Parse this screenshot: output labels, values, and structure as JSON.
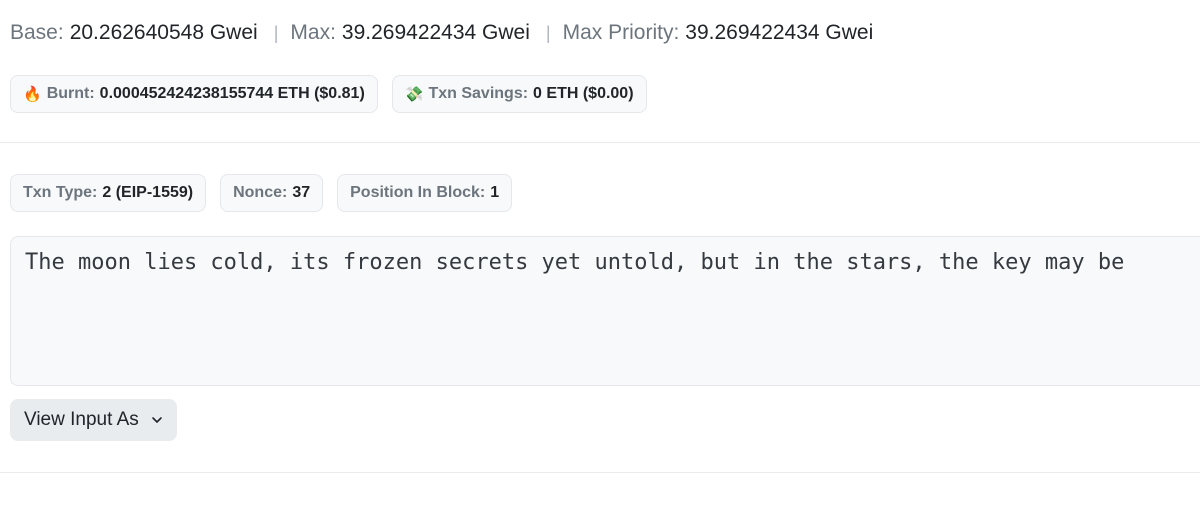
{
  "gas": {
    "base_label": "Base:",
    "base_value": "20.262640548 Gwei",
    "max_label": "Max:",
    "max_value": "39.269422434 Gwei",
    "max_priority_label": "Max Priority:",
    "max_priority_value": "39.269422434 Gwei",
    "separator": "|"
  },
  "fees": {
    "burnt_icon": "fire-icon",
    "burnt_glyph": "🔥",
    "burnt_label": "Burnt:",
    "burnt_value": "0.000452424238155744 ETH ($0.81)",
    "savings_icon": "money-icon",
    "savings_glyph": "💸",
    "savings_label": "Txn Savings:",
    "savings_value": "0 ETH ($0.00)"
  },
  "attributes": {
    "txn_type_label": "Txn Type:",
    "txn_type_value": "2 (EIP-1559)",
    "nonce_label": "Nonce:",
    "nonce_value": "37",
    "position_label": "Position In Block:",
    "position_value": "1"
  },
  "input_data": {
    "text": "The moon lies cold, its frozen secrets yet untold, but in the stars, the key may be"
  },
  "view_input": {
    "label": "View Input As",
    "icon": "chevron-down-icon"
  },
  "colors": {
    "label_gray": "#6c757d",
    "chip_bg": "#f8f9fa",
    "chip_border": "#e5e7eb",
    "button_bg": "#e9ecef"
  }
}
